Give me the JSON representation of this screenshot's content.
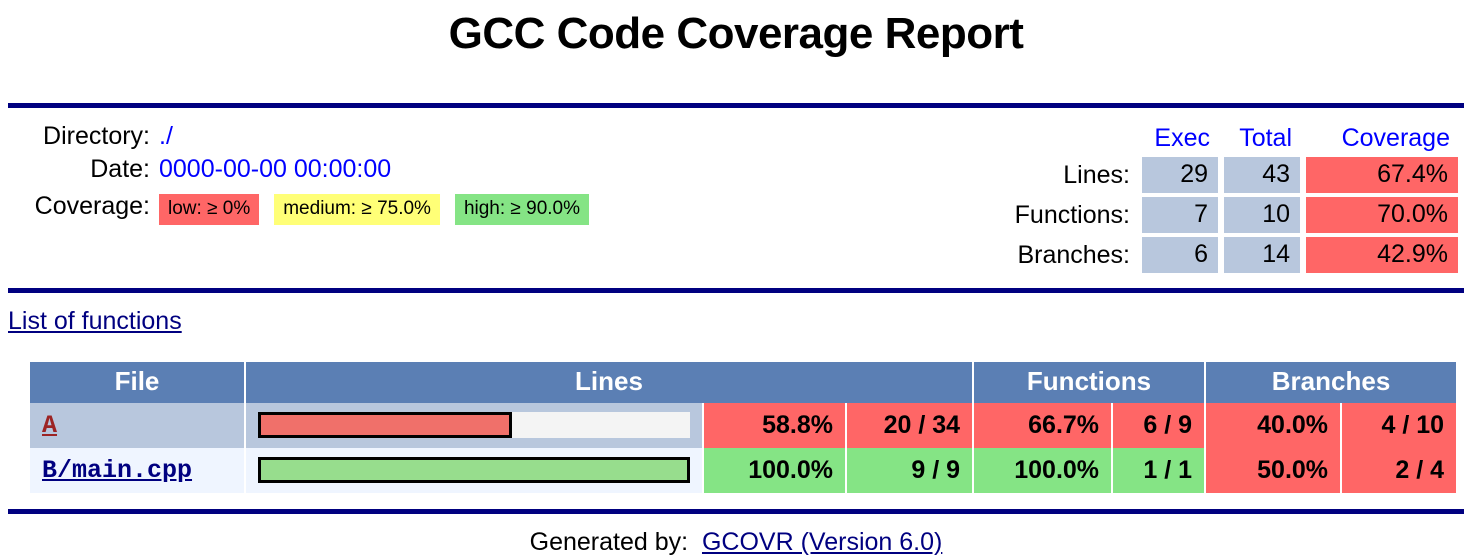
{
  "page": {
    "title": "GCC Code Coverage Report"
  },
  "meta": {
    "directory_label": "Directory:",
    "directory_value": "./",
    "date_label": "Date:",
    "date_value": "0000-00-00 00:00:00",
    "coverage_label": "Coverage:",
    "legend": [
      {
        "text": "low: ≥ 0%",
        "color": "#ff6666"
      },
      {
        "text": "medium: ≥ 75.0%",
        "color": "#ffff77"
      },
      {
        "text": "high: ≥ 90.0%",
        "color": "#85e485"
      }
    ]
  },
  "stats": {
    "headers": {
      "exec": "Exec",
      "total": "Total",
      "coverage": "Coverage"
    },
    "rows": [
      {
        "label": "Lines:",
        "exec": "29",
        "total": "43",
        "coverage": "67.4%",
        "coverage_color": "#ff6666"
      },
      {
        "label": "Functions:",
        "exec": "7",
        "total": "10",
        "coverage": "70.0%",
        "coverage_color": "#ff6666"
      },
      {
        "label": "Branches:",
        "exec": "6",
        "total": "14",
        "coverage": "42.9%",
        "coverage_color": "#ff6666"
      }
    ]
  },
  "links": {
    "list_of_functions": "List of functions"
  },
  "coverage_table": {
    "headers": {
      "file": "File",
      "lines": "Lines",
      "functions": "Functions",
      "branches": "Branches"
    },
    "rows": [
      {
        "file": "A",
        "lines_percent": "58.8%",
        "lines_ratio": "20 / 34",
        "lines_bar_percent": 58.8,
        "lines_class": "low",
        "functions_percent": "66.7%",
        "functions_ratio": "6 / 9",
        "functions_class": "low",
        "branches_percent": "40.0%",
        "branches_ratio": "4 / 10",
        "branches_class": "low"
      },
      {
        "file": "B/main.cpp",
        "lines_percent": "100.0%",
        "lines_ratio": "9 / 9",
        "lines_bar_percent": 100.0,
        "lines_class": "high",
        "functions_percent": "100.0%",
        "functions_ratio": "1 / 1",
        "functions_class": "high",
        "branches_percent": "50.0%",
        "branches_ratio": "2 / 4",
        "branches_class": "low"
      }
    ]
  },
  "footer": {
    "generated_by": "Generated by:",
    "gcovr_link": "GCOVR (Version 6.0)"
  },
  "colors": {
    "rule": "#000080",
    "header_bg": "#5b7fb4",
    "low": "#ff6666",
    "medium": "#ffff77",
    "high": "#85e485",
    "row_odd": "#b8c7dd",
    "row_even": "#eff5ff",
    "link_blue": "#0000ff",
    "link_navy": "#000080"
  }
}
